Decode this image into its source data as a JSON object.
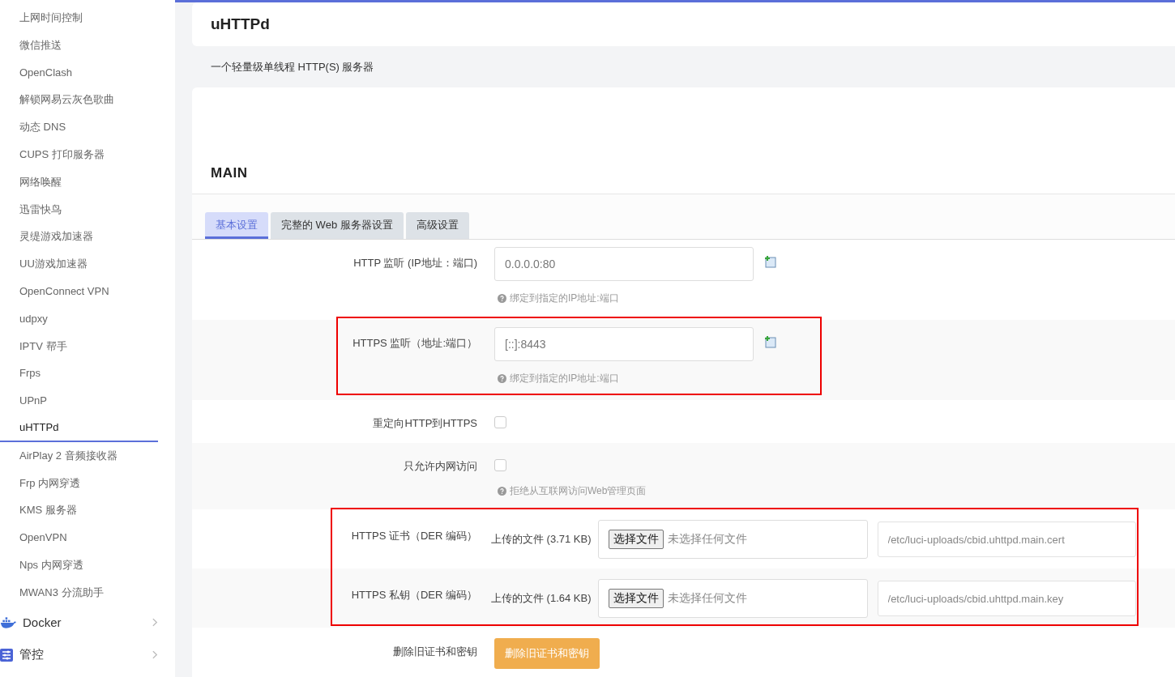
{
  "sidebar": {
    "items": [
      {
        "label": "上网时间控制",
        "selected": false
      },
      {
        "label": "微信推送",
        "selected": false
      },
      {
        "label": "OpenClash",
        "selected": false
      },
      {
        "label": "解锁网易云灰色歌曲",
        "selected": false
      },
      {
        "label": "动态 DNS",
        "selected": false
      },
      {
        "label": "CUPS 打印服务器",
        "selected": false
      },
      {
        "label": "网络唤醒",
        "selected": false
      },
      {
        "label": "迅雷快鸟",
        "selected": false
      },
      {
        "label": "灵缇游戏加速器",
        "selected": false
      },
      {
        "label": "UU游戏加速器",
        "selected": false
      },
      {
        "label": "OpenConnect VPN",
        "selected": false
      },
      {
        "label": "udpxy",
        "selected": false
      },
      {
        "label": "IPTV 帮手",
        "selected": false
      },
      {
        "label": "Frps",
        "selected": false
      },
      {
        "label": "UPnP",
        "selected": false
      },
      {
        "label": "uHTTPd",
        "selected": true
      },
      {
        "label": "AirPlay 2 音频接收器",
        "selected": false
      },
      {
        "label": "Frp 内网穿透",
        "selected": false
      },
      {
        "label": "KMS 服务器",
        "selected": false
      },
      {
        "label": "OpenVPN",
        "selected": false
      },
      {
        "label": "Nps 内网穿透",
        "selected": false
      },
      {
        "label": "MWAN3 分流助手",
        "selected": false
      }
    ],
    "groups": [
      {
        "label": "Docker",
        "kind": "docker"
      },
      {
        "label": "管控",
        "kind": "control"
      }
    ]
  },
  "header": {
    "title": "uHTTPd"
  },
  "description": "一个轻量级单线程 HTTP(S) 服务器",
  "section": {
    "title": "MAIN",
    "tabs": [
      {
        "label": "基本设置",
        "selected": true
      },
      {
        "label": "完整的 Web 服务器设置",
        "selected": false
      },
      {
        "label": "高级设置",
        "selected": false
      }
    ],
    "blocks": [
      {
        "highlighted": false,
        "rows": [
          {
            "kind": "text",
            "label": "HTTP 监听 (IP地址：端口)",
            "value": "0.0.0.0:80",
            "hint": "绑定到指定的IP地址:端口"
          }
        ]
      },
      {
        "highlighted": true,
        "rows": [
          {
            "kind": "text",
            "label": "HTTPS 监听（地址:端口）",
            "value": "[::]:8443",
            "hint": "绑定到指定的IP地址:端口"
          }
        ]
      },
      {
        "highlighted": false,
        "rows": [
          {
            "kind": "checkbox",
            "label": "重定向HTTP到HTTPS",
            "checked": false
          },
          {
            "kind": "checkbox",
            "label": "只允许内网访问",
            "checked": false,
            "hint": "拒绝从互联网访问Web管理页面"
          }
        ]
      },
      {
        "highlighted": true,
        "rows": [
          {
            "kind": "file",
            "label": "HTTPS 证书（DER 编码）",
            "uploaded": "上传的文件 (3.71 KB)",
            "button": "选择文件",
            "status": "未选择任何文件",
            "path": "/etc/luci-uploads/cbid.uhttpd.main.cert"
          },
          {
            "kind": "file",
            "label": "HTTPS 私钥（DER 编码）",
            "uploaded": "上传的文件 (1.64 KB)",
            "button": "选择文件",
            "status": "未选择任何文件",
            "path": "/etc/luci-uploads/cbid.uhttpd.main.key"
          }
        ]
      },
      {
        "highlighted": false,
        "rows": [
          {
            "kind": "button",
            "label": "删除旧证书和密钥",
            "button": "删除旧证书和密钥"
          }
        ]
      }
    ]
  }
}
